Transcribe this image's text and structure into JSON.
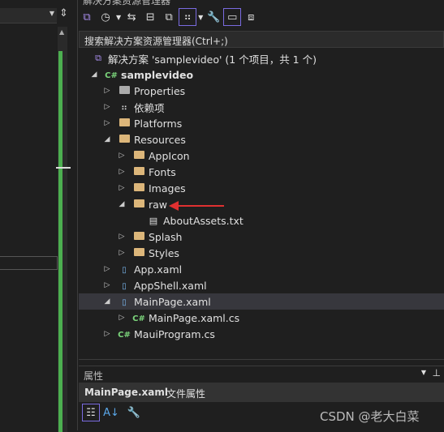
{
  "panel_title": "解决方案资源管理器",
  "search": {
    "placeholder": "搜索解决方案资源管理器(Ctrl+;)"
  },
  "tree": [
    {
      "label": "解决方案 'samplevideo' (1 个项目，共 1 个)",
      "level": 0,
      "icon": "solution-icon",
      "arrow": ""
    },
    {
      "label": "samplevideo",
      "level": 1,
      "icon": "csharp-project-icon",
      "arrow": "expanded",
      "bold": true
    },
    {
      "label": "Properties",
      "level": 2,
      "icon": "wrench-folder-icon",
      "arrow": "collapsed"
    },
    {
      "label": "依赖项",
      "level": 2,
      "icon": "dependencies-icon",
      "arrow": "collapsed"
    },
    {
      "label": "Platforms",
      "level": 2,
      "icon": "folder-icon",
      "arrow": "collapsed"
    },
    {
      "label": "Resources",
      "level": 2,
      "icon": "folder-icon",
      "arrow": "expanded"
    },
    {
      "label": "AppIcon",
      "level": 3,
      "icon": "folder-icon",
      "arrow": "collapsed"
    },
    {
      "label": "Fonts",
      "level": 3,
      "icon": "folder-icon",
      "arrow": "collapsed"
    },
    {
      "label": "Images",
      "level": 3,
      "icon": "folder-icon",
      "arrow": "collapsed"
    },
    {
      "label": "raw",
      "level": 3,
      "icon": "folder-icon",
      "arrow": "expanded"
    },
    {
      "label": "AboutAssets.txt",
      "level": 4,
      "icon": "text-file-icon",
      "arrow": ""
    },
    {
      "label": "Splash",
      "level": 3,
      "icon": "folder-icon",
      "arrow": "collapsed"
    },
    {
      "label": "Styles",
      "level": 3,
      "icon": "folder-icon",
      "arrow": "collapsed"
    },
    {
      "label": "App.xaml",
      "level": 2,
      "icon": "xaml-file-icon",
      "arrow": "collapsed"
    },
    {
      "label": "AppShell.xaml",
      "level": 2,
      "icon": "xaml-file-icon",
      "arrow": "collapsed"
    },
    {
      "label": "MainPage.xaml",
      "level": 2,
      "icon": "xaml-file-icon",
      "arrow": "expanded",
      "selected": true
    },
    {
      "label": "MainPage.xaml.cs",
      "level": 3,
      "icon": "csharp-file-icon",
      "arrow": "collapsed"
    },
    {
      "label": "MauiProgram.cs",
      "level": 2,
      "icon": "csharp-file-icon",
      "arrow": "collapsed"
    }
  ],
  "properties": {
    "title": "属性",
    "object_name": "MainPage.xaml",
    "object_type": "文件属性"
  },
  "watermark": "CSDN @老大白菜",
  "colors": {
    "accent": "#7a6be0",
    "annotation_arrow": "#e03030",
    "green_bar": "#4caf50"
  }
}
